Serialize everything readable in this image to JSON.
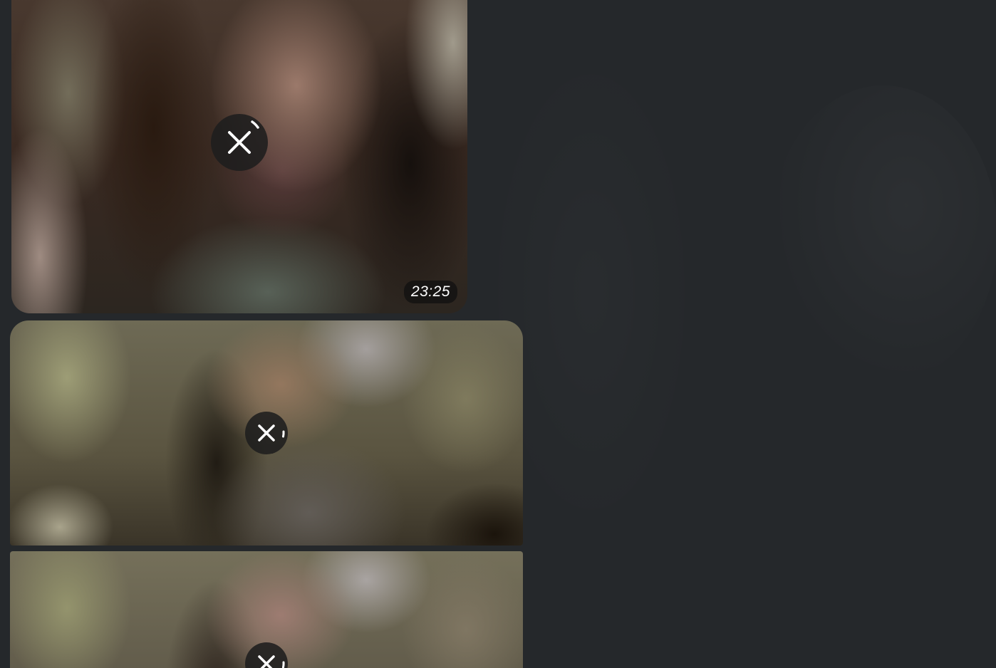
{
  "messages": [
    {
      "type": "video",
      "state": "downloading",
      "duration": "23:25",
      "cancel_icon": "close-icon",
      "progress_icon": "progress-ring-icon"
    },
    {
      "type": "photo",
      "state": "downloading",
      "cancel_icon": "close-icon",
      "progress_icon": "progress-ring-icon"
    },
    {
      "type": "photo",
      "state": "downloading",
      "cancel_icon": "close-icon",
      "progress_icon": "progress-ring-icon"
    }
  ],
  "colors": {
    "background": "#25282b",
    "overlay_button": "#1e1e1e",
    "icon": "#ffffff"
  }
}
